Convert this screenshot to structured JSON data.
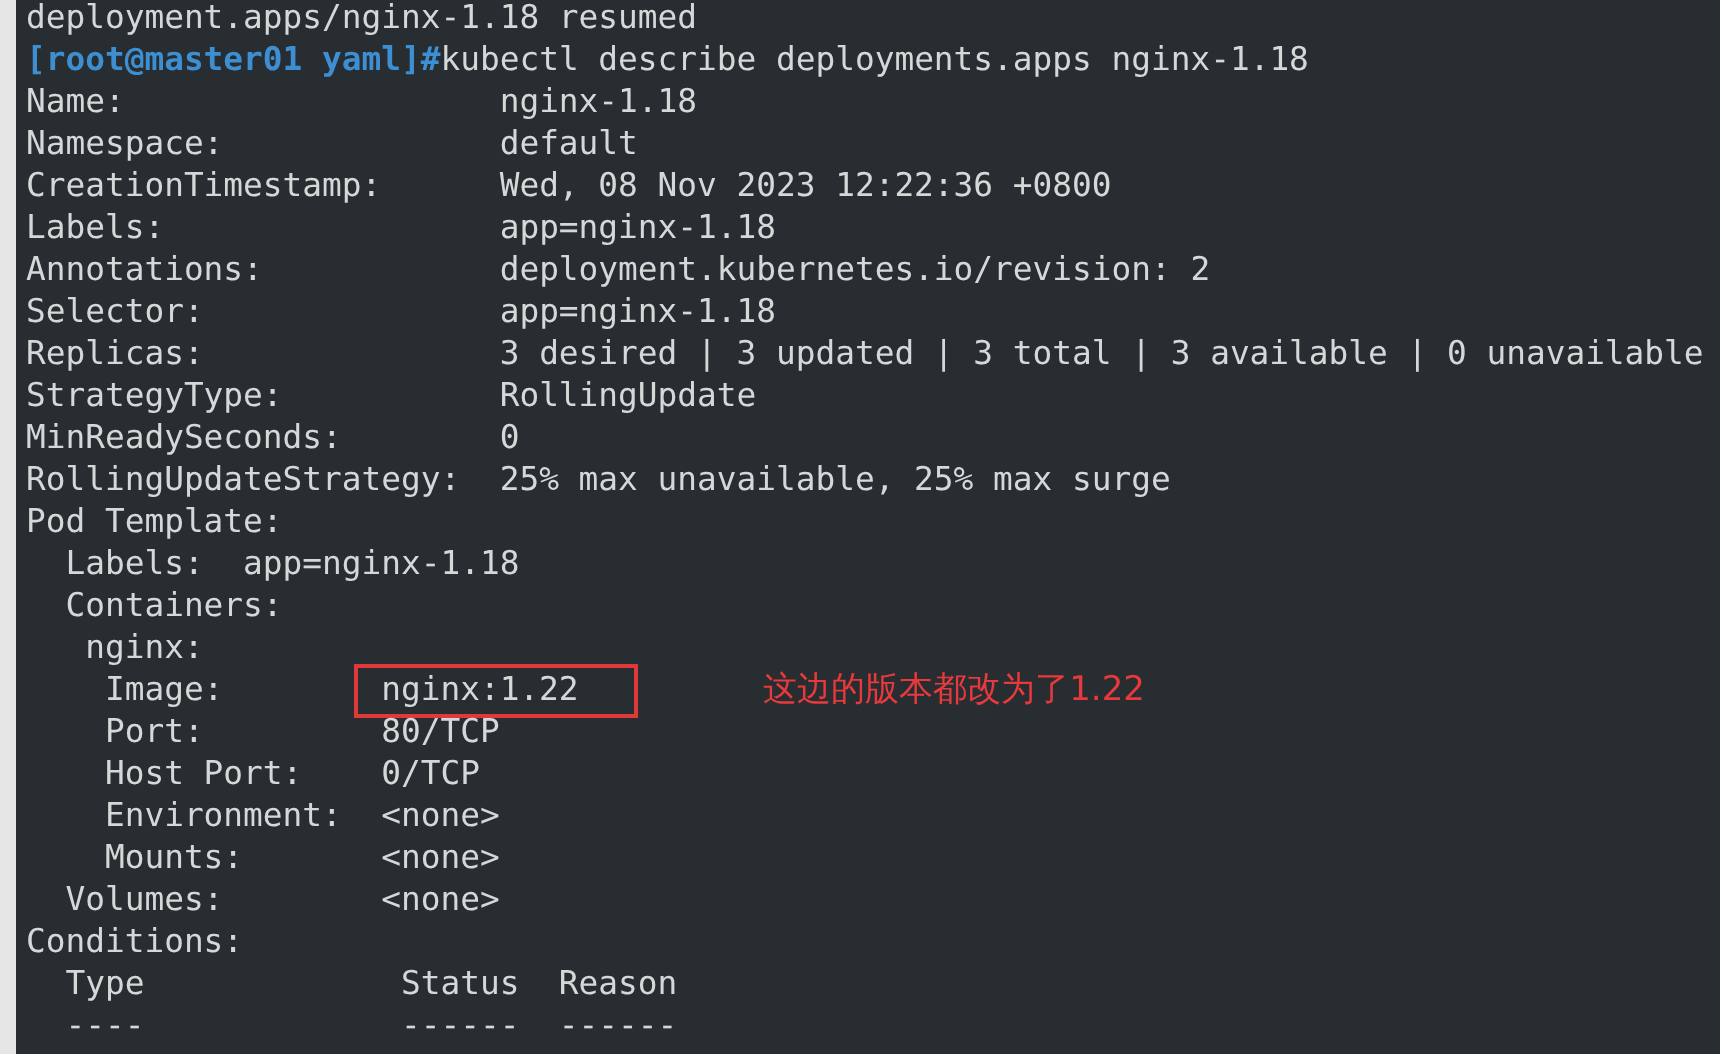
{
  "lines_before": [
    {
      "kind": "output",
      "text": "deployment.apps/nginx-1.18 resumed"
    },
    {
      "kind": "prompt",
      "prompt": "[root@master01 yaml]#",
      "command": "kubectl describe deployments.apps nginx-1.18"
    }
  ],
  "fields": [
    {
      "label": "Name:",
      "value": "nginx-1.18"
    },
    {
      "label": "Namespace:",
      "value": "default"
    },
    {
      "label": "CreationTimestamp:",
      "value": "Wed, 08 Nov 2023 12:22:36 +0800"
    },
    {
      "label": "Labels:",
      "value": "app=nginx-1.18"
    },
    {
      "label": "Annotations:",
      "value": "deployment.kubernetes.io/revision: 2"
    },
    {
      "label": "Selector:",
      "value": "app=nginx-1.18"
    },
    {
      "label": "Replicas:",
      "value": "3 desired | 3 updated | 3 total | 3 available | 0 unavailable"
    },
    {
      "label": "StrategyType:",
      "value": "RollingUpdate"
    },
    {
      "label": "MinReadySeconds:",
      "value": "0"
    },
    {
      "label": "RollingUpdateStrategy:",
      "value": "25% max unavailable, 25% max surge"
    }
  ],
  "pod_template": {
    "label": "Pod Template:",
    "labels": {
      "label": "Labels:",
      "value": "app=nginx-1.18"
    },
    "containers": {
      "label": "Containers:",
      "children": [
        {
          "label": "nginx:",
          "children": [
            {
              "label": "Image:",
              "value": "nginx:1.22",
              "highlighted": true
            },
            {
              "label": "Port:",
              "value": "80/TCP",
              "highlighted": false
            },
            {
              "label": "Host Port:",
              "value": "0/TCP",
              "highlighted": false
            },
            {
              "label": "Environment:",
              "value": "<none>",
              "highlighted": false
            },
            {
              "label": "Mounts:",
              "value": "<none>",
              "highlighted": false
            }
          ]
        }
      ]
    },
    "volumes": {
      "label": "Volumes:",
      "value": "<none>"
    }
  },
  "conditions": {
    "label": "Conditions:",
    "columns": [
      "Type",
      "Status",
      "Reason"
    ],
    "separators": [
      "----",
      "------",
      "------"
    ]
  },
  "annotation": {
    "text": "这边的版本都改为了1.22"
  }
}
